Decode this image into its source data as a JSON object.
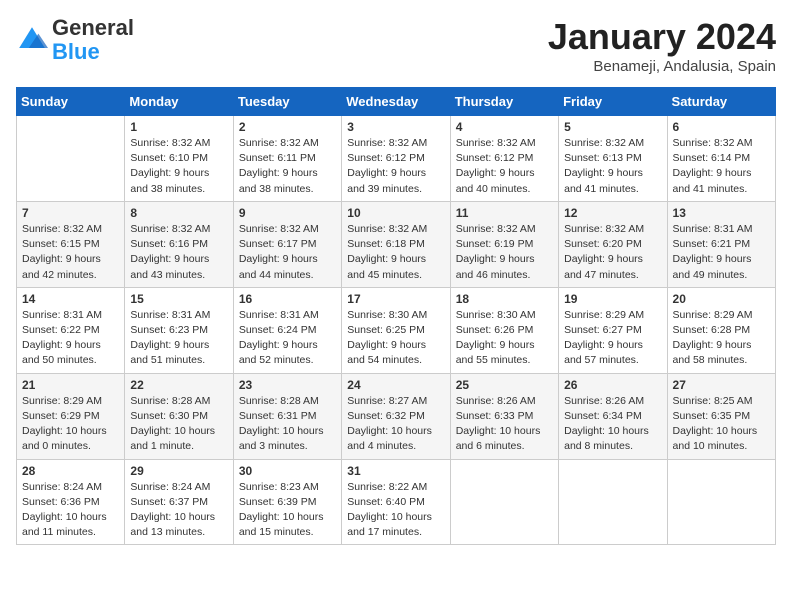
{
  "header": {
    "logo_general": "General",
    "logo_blue": "Blue",
    "month_title": "January 2024",
    "location": "Benameji, Andalusia, Spain"
  },
  "days_of_week": [
    "Sunday",
    "Monday",
    "Tuesday",
    "Wednesday",
    "Thursday",
    "Friday",
    "Saturday"
  ],
  "weeks": [
    [
      {
        "day": "",
        "info": ""
      },
      {
        "day": "1",
        "info": "Sunrise: 8:32 AM\nSunset: 6:10 PM\nDaylight: 9 hours\nand 38 minutes."
      },
      {
        "day": "2",
        "info": "Sunrise: 8:32 AM\nSunset: 6:11 PM\nDaylight: 9 hours\nand 38 minutes."
      },
      {
        "day": "3",
        "info": "Sunrise: 8:32 AM\nSunset: 6:12 PM\nDaylight: 9 hours\nand 39 minutes."
      },
      {
        "day": "4",
        "info": "Sunrise: 8:32 AM\nSunset: 6:12 PM\nDaylight: 9 hours\nand 40 minutes."
      },
      {
        "day": "5",
        "info": "Sunrise: 8:32 AM\nSunset: 6:13 PM\nDaylight: 9 hours\nand 41 minutes."
      },
      {
        "day": "6",
        "info": "Sunrise: 8:32 AM\nSunset: 6:14 PM\nDaylight: 9 hours\nand 41 minutes."
      }
    ],
    [
      {
        "day": "7",
        "info": "Sunrise: 8:32 AM\nSunset: 6:15 PM\nDaylight: 9 hours\nand 42 minutes."
      },
      {
        "day": "8",
        "info": "Sunrise: 8:32 AM\nSunset: 6:16 PM\nDaylight: 9 hours\nand 43 minutes."
      },
      {
        "day": "9",
        "info": "Sunrise: 8:32 AM\nSunset: 6:17 PM\nDaylight: 9 hours\nand 44 minutes."
      },
      {
        "day": "10",
        "info": "Sunrise: 8:32 AM\nSunset: 6:18 PM\nDaylight: 9 hours\nand 45 minutes."
      },
      {
        "day": "11",
        "info": "Sunrise: 8:32 AM\nSunset: 6:19 PM\nDaylight: 9 hours\nand 46 minutes."
      },
      {
        "day": "12",
        "info": "Sunrise: 8:32 AM\nSunset: 6:20 PM\nDaylight: 9 hours\nand 47 minutes."
      },
      {
        "day": "13",
        "info": "Sunrise: 8:31 AM\nSunset: 6:21 PM\nDaylight: 9 hours\nand 49 minutes."
      }
    ],
    [
      {
        "day": "14",
        "info": "Sunrise: 8:31 AM\nSunset: 6:22 PM\nDaylight: 9 hours\nand 50 minutes."
      },
      {
        "day": "15",
        "info": "Sunrise: 8:31 AM\nSunset: 6:23 PM\nDaylight: 9 hours\nand 51 minutes."
      },
      {
        "day": "16",
        "info": "Sunrise: 8:31 AM\nSunset: 6:24 PM\nDaylight: 9 hours\nand 52 minutes."
      },
      {
        "day": "17",
        "info": "Sunrise: 8:30 AM\nSunset: 6:25 PM\nDaylight: 9 hours\nand 54 minutes."
      },
      {
        "day": "18",
        "info": "Sunrise: 8:30 AM\nSunset: 6:26 PM\nDaylight: 9 hours\nand 55 minutes."
      },
      {
        "day": "19",
        "info": "Sunrise: 8:29 AM\nSunset: 6:27 PM\nDaylight: 9 hours\nand 57 minutes."
      },
      {
        "day": "20",
        "info": "Sunrise: 8:29 AM\nSunset: 6:28 PM\nDaylight: 9 hours\nand 58 minutes."
      }
    ],
    [
      {
        "day": "21",
        "info": "Sunrise: 8:29 AM\nSunset: 6:29 PM\nDaylight: 10 hours\nand 0 minutes."
      },
      {
        "day": "22",
        "info": "Sunrise: 8:28 AM\nSunset: 6:30 PM\nDaylight: 10 hours\nand 1 minute."
      },
      {
        "day": "23",
        "info": "Sunrise: 8:28 AM\nSunset: 6:31 PM\nDaylight: 10 hours\nand 3 minutes."
      },
      {
        "day": "24",
        "info": "Sunrise: 8:27 AM\nSunset: 6:32 PM\nDaylight: 10 hours\nand 4 minutes."
      },
      {
        "day": "25",
        "info": "Sunrise: 8:26 AM\nSunset: 6:33 PM\nDaylight: 10 hours\nand 6 minutes."
      },
      {
        "day": "26",
        "info": "Sunrise: 8:26 AM\nSunset: 6:34 PM\nDaylight: 10 hours\nand 8 minutes."
      },
      {
        "day": "27",
        "info": "Sunrise: 8:25 AM\nSunset: 6:35 PM\nDaylight: 10 hours\nand 10 minutes."
      }
    ],
    [
      {
        "day": "28",
        "info": "Sunrise: 8:24 AM\nSunset: 6:36 PM\nDaylight: 10 hours\nand 11 minutes."
      },
      {
        "day": "29",
        "info": "Sunrise: 8:24 AM\nSunset: 6:37 PM\nDaylight: 10 hours\nand 13 minutes."
      },
      {
        "day": "30",
        "info": "Sunrise: 8:23 AM\nSunset: 6:39 PM\nDaylight: 10 hours\nand 15 minutes."
      },
      {
        "day": "31",
        "info": "Sunrise: 8:22 AM\nSunset: 6:40 PM\nDaylight: 10 hours\nand 17 minutes."
      },
      {
        "day": "",
        "info": ""
      },
      {
        "day": "",
        "info": ""
      },
      {
        "day": "",
        "info": ""
      }
    ]
  ]
}
